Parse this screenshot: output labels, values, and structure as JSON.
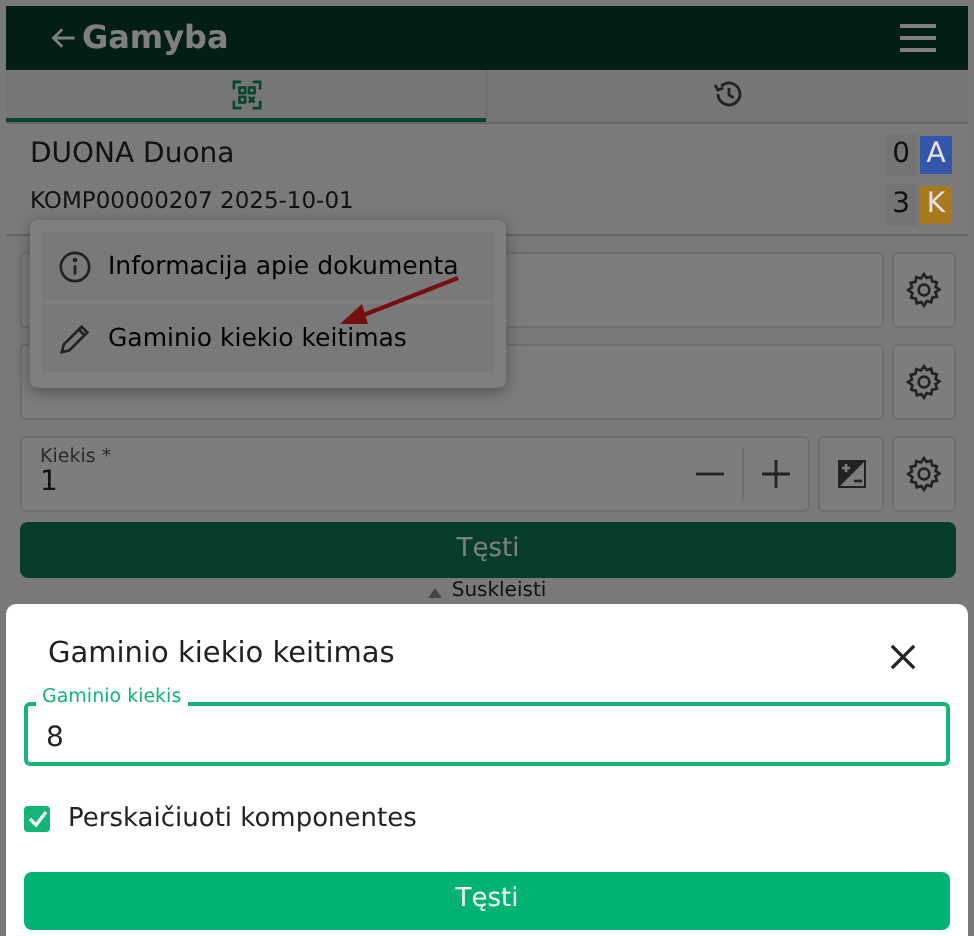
{
  "header": {
    "title": "Gamyba"
  },
  "tabs": [
    {
      "kind": "scan",
      "selected": true
    },
    {
      "kind": "history",
      "selected": false
    }
  ],
  "document": {
    "name": "DUONA Duona",
    "code": "KOMP00000207 2025-10-01",
    "counters": [
      {
        "count": "0",
        "badge": "A",
        "color": "#3355aa"
      },
      {
        "count": "3",
        "badge": "K",
        "color": "#a87a20"
      }
    ]
  },
  "context_menu": {
    "items": [
      {
        "kind": "info",
        "label": "Informacija apie dokumenta"
      },
      {
        "kind": "edit",
        "label": "Gaminio kiekio keitimas"
      }
    ]
  },
  "form": {
    "quantity": {
      "label": "Kiekis *",
      "value": "1"
    },
    "continue_button": "Tęsti",
    "collapse_link": "Suskleisti"
  },
  "modal": {
    "title": "Gaminio kiekio keitimas",
    "field": {
      "label": "Gaminio kiekis",
      "value": "8"
    },
    "checkbox": {
      "label": "Perskaičiuoti komponentes",
      "checked": true
    },
    "button": "Tęsti"
  }
}
